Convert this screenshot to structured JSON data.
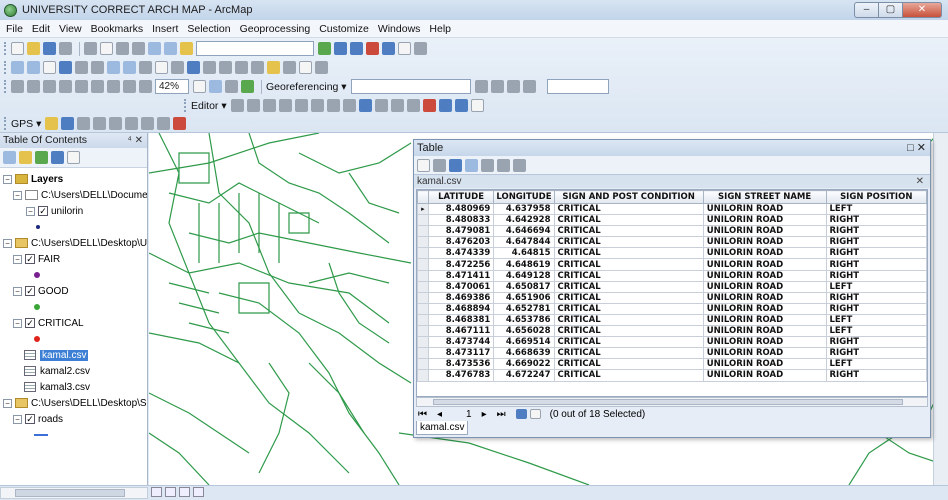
{
  "window": {
    "title": "UNIVERSITY CORRECT ARCH MAP - ArcMap",
    "min": "–",
    "max": "▢",
    "close": "✕"
  },
  "menu": [
    "File",
    "Edit",
    "View",
    "Bookmarks",
    "Insert",
    "Selection",
    "Geoprocessing",
    "Customize",
    "Windows",
    "Help"
  ],
  "toolbar": {
    "zoom_value": "42%",
    "georeferencing_label": "Georeferencing ▾",
    "editor_label": "Editor ▾",
    "gps_label": "GPS ▾"
  },
  "toc": {
    "title": "Table Of Contents",
    "pin": "⁴ ✕",
    "layers_label": "Layers",
    "items": [
      {
        "label": "C:\\Users\\DELL\\Documen"
      },
      {
        "label": "unilorin"
      },
      {
        "label": "C:\\Users\\DELL\\Desktop\\U"
      },
      {
        "label": "FAIR"
      },
      {
        "label": "GOOD"
      },
      {
        "label": "CRITICAL"
      },
      {
        "label": "kamal.csv"
      },
      {
        "label": "kamal2.csv"
      },
      {
        "label": "kamal3.csv"
      },
      {
        "label": "C:\\Users\\DELL\\Desktop\\S"
      },
      {
        "label": "roads"
      }
    ],
    "colors": {
      "fair": "#7a1f8f",
      "good": "#3aa537",
      "critical": "#e0231b",
      "unilorin": "#1e2a80",
      "roads": "#3c6fd8"
    }
  },
  "table_window": {
    "title": "Table",
    "controls": "□ ✕",
    "tab_label": "kamal.csv",
    "tab_close": "✕",
    "columns": [
      "LATITUDE",
      "LONGITUDE",
      "SIGN AND POST CONDITION",
      "SIGN STREET NAME",
      "SIGN POSITION"
    ],
    "rows": [
      [
        "8.480969",
        "4.637958",
        "CRITICAL",
        "UNILORIN ROAD",
        "LEFT"
      ],
      [
        "8.480833",
        "4.642928",
        "CRITICAL",
        "UNILORIN ROAD",
        "RIGHT"
      ],
      [
        "8.479081",
        "4.646694",
        "CRITICAL",
        "UNILORIN ROAD",
        "RIGHT"
      ],
      [
        "8.476203",
        "4.647844",
        "CRITICAL",
        "UNILORIN ROAD",
        "RIGHT"
      ],
      [
        "8.474339",
        "4.64815",
        "CRITICAL",
        "UNILORIN ROAD",
        "RIGHT"
      ],
      [
        "8.472256",
        "4.648619",
        "CRITICAL",
        "UNILORIN ROAD",
        "RIGHT"
      ],
      [
        "8.471411",
        "4.649128",
        "CRITICAL",
        "UNILORIN ROAD",
        "RIGHT"
      ],
      [
        "8.470061",
        "4.650817",
        "CRITICAL",
        "UNILORIN ROAD",
        "LEFT"
      ],
      [
        "8.469386",
        "4.651906",
        "CRITICAL",
        "UNILORIN ROAD",
        "RIGHT"
      ],
      [
        "8.468894",
        "4.652781",
        "CRITICAL",
        "UNILORIN ROAD",
        "RIGHT"
      ],
      [
        "8.468381",
        "4.653786",
        "CRITICAL",
        "UNILORIN ROAD",
        "LEFT"
      ],
      [
        "8.467111",
        "4.656028",
        "CRITICAL",
        "UNILORIN ROAD",
        "LEFT"
      ],
      [
        "8.473744",
        "4.669514",
        "CRITICAL",
        "UNILORIN ROAD",
        "RIGHT"
      ],
      [
        "8.473117",
        "4.668639",
        "CRITICAL",
        "UNILORIN ROAD",
        "RIGHT"
      ],
      [
        "8.473536",
        "4.669022",
        "CRITICAL",
        "UNILORIN ROAD",
        "LEFT"
      ],
      [
        "8.476783",
        "4.672247",
        "CRITICAL",
        "UNILORIN ROAD",
        "RIGHT"
      ]
    ],
    "nav": {
      "first": "⏮",
      "prev": "◂",
      "record": "1",
      "next": "▸",
      "last": "⏭",
      "selection": "(0 out of 18 Selected)"
    },
    "bottom_tab": "kamal.csv"
  }
}
